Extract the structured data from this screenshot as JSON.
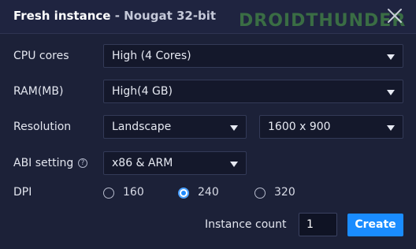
{
  "window": {
    "title": "Fresh instance",
    "subtitle": "- Nougat 32-bit",
    "watermark": "DROIDTHUNDER"
  },
  "fields": {
    "cpu": {
      "label": "CPU cores",
      "value": "High (4 Cores)"
    },
    "ram": {
      "label": "RAM(MB)",
      "value": "High(4 GB)"
    },
    "resolution": {
      "label": "Resolution",
      "orientation": "Landscape",
      "size": "1600 x 900"
    },
    "abi": {
      "label": "ABI setting",
      "value": "x86 & ARM"
    },
    "dpi": {
      "label": "DPI",
      "options": [
        "160",
        "240",
        "320"
      ],
      "selected": "240"
    }
  },
  "footer": {
    "instance_count_label": "Instance count",
    "instance_count": "1",
    "create_label": "Create"
  },
  "colors": {
    "background": "#1c2138",
    "accent": "#1a8cff",
    "watermark": "#3f7a45"
  },
  "icons": {
    "close": "close-icon",
    "help": "help-icon",
    "dropdown": "chevron-down-icon"
  }
}
